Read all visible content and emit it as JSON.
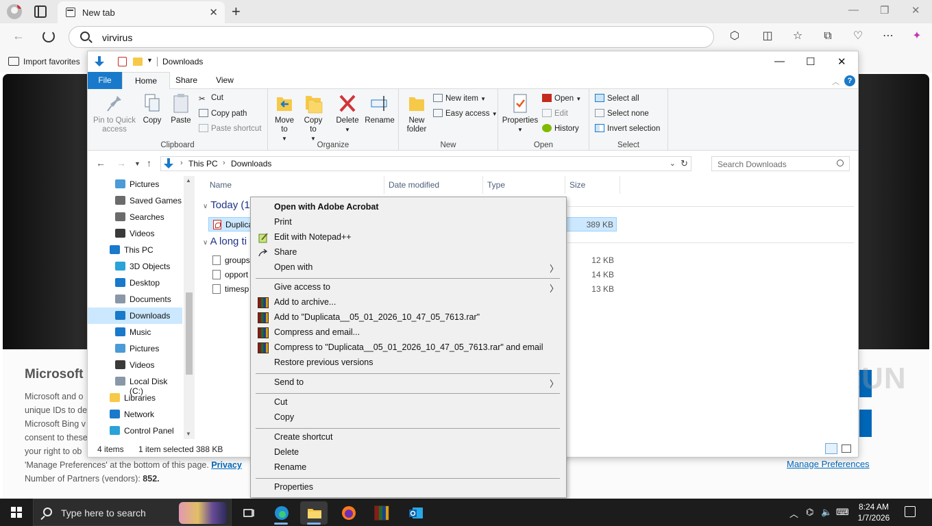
{
  "browser": {
    "tab_title": "New tab",
    "address": "virvirus",
    "favorites_import": "Import favorites"
  },
  "page": {
    "heading": "Microsoft (",
    "paragraph_lines": [
      "Microsoft and o",
      "unique IDs to de",
      "Microsoft Bing v",
      "consent to these",
      "your right to ob"
    ],
    "manage_line": "'Manage Preferences' at the bottom of this page.",
    "privacy_link": "Privacy",
    "partners_label": "Number of Partners (vendors):",
    "partners_count": "852.",
    "manage_preferences": "Manage Preferences",
    "watermark": "ANY RUN"
  },
  "explorer": {
    "title": "Downloads",
    "tabs": {
      "file": "File",
      "home": "Home",
      "share": "Share",
      "view": "View"
    },
    "clipboard": {
      "pin": "Pin to Quick access",
      "copy": "Copy",
      "paste": "Paste",
      "cut": "Cut",
      "copy_path": "Copy path",
      "paste_shortcut": "Paste shortcut",
      "label": "Clipboard"
    },
    "organize": {
      "move_to": "Move to",
      "copy_to": "Copy to",
      "delete": "Delete",
      "rename": "Rename",
      "label": "Organize"
    },
    "new": {
      "new_folder": "New folder",
      "new_item": "New item",
      "easy_access": "Easy access",
      "label": "New"
    },
    "open": {
      "properties": "Properties",
      "open": "Open",
      "edit": "Edit",
      "history": "History",
      "label": "Open"
    },
    "select": {
      "select_all": "Select all",
      "select_none": "Select none",
      "invert": "Invert selection",
      "label": "Select"
    },
    "breadcrumb": [
      "This PC",
      "Downloads"
    ],
    "search_placeholder": "Search Downloads",
    "nav_items": [
      {
        "label": "Pictures",
        "icon": "pictures-icon"
      },
      {
        "label": "Saved Games",
        "icon": "saved-games-icon"
      },
      {
        "label": "Searches",
        "icon": "searches-icon"
      },
      {
        "label": "Videos",
        "icon": "videos-icon"
      },
      {
        "label": "This PC",
        "icon": "this-pc-icon"
      },
      {
        "label": "3D Objects",
        "icon": "3d-objects-icon"
      },
      {
        "label": "Desktop",
        "icon": "desktop-icon"
      },
      {
        "label": "Documents",
        "icon": "documents-icon"
      },
      {
        "label": "Downloads",
        "icon": "downloads-icon"
      },
      {
        "label": "Music",
        "icon": "music-icon"
      },
      {
        "label": "Pictures",
        "icon": "pictures-icon"
      },
      {
        "label": "Videos",
        "icon": "videos-icon"
      },
      {
        "label": "Local Disk (C:)",
        "icon": "drive-icon"
      },
      {
        "label": "Libraries",
        "icon": "libraries-icon"
      },
      {
        "label": "Network",
        "icon": "network-icon"
      },
      {
        "label": "Control Panel",
        "icon": "control-panel-icon"
      }
    ],
    "columns": {
      "name": "Name",
      "date": "Date modified",
      "type": "Type",
      "size": "Size"
    },
    "groups": {
      "today": "Today (1",
      "long_ago": "A long ti"
    },
    "files": [
      {
        "name": "Duplica",
        "size": "389 KB",
        "selected": true
      },
      {
        "name": "groups",
        "size": "12 KB"
      },
      {
        "name": "opport",
        "size": "14 KB"
      },
      {
        "name": "timesp",
        "size": "13 KB"
      }
    ],
    "status": {
      "items": "4 items",
      "selected": "1 item selected",
      "size": "388 KB"
    }
  },
  "context_menu": {
    "items": [
      {
        "label": "Open with Adobe Acrobat",
        "bold": true
      },
      {
        "label": "Print"
      },
      {
        "label": "Edit with Notepad++"
      },
      {
        "label": "Share"
      },
      {
        "label": "Open with"
      },
      {
        "label": "Give access to"
      },
      {
        "label": "Add to archive..."
      },
      {
        "label": "Add to \"Duplicata__05_01_2026_10_47_05_7613.rar\""
      },
      {
        "label": "Compress and email..."
      },
      {
        "label": "Compress to \"Duplicata__05_01_2026_10_47_05_7613.rar\" and email"
      },
      {
        "label": "Restore previous versions"
      },
      {
        "label": "Send to"
      },
      {
        "label": "Cut"
      },
      {
        "label": "Copy"
      },
      {
        "label": "Create shortcut"
      },
      {
        "label": "Delete"
      },
      {
        "label": "Rename"
      },
      {
        "label": "Properties"
      }
    ]
  },
  "taskbar": {
    "search_placeholder": "Type here to search",
    "time": "8:24 AM",
    "date": "1/7/2026"
  }
}
